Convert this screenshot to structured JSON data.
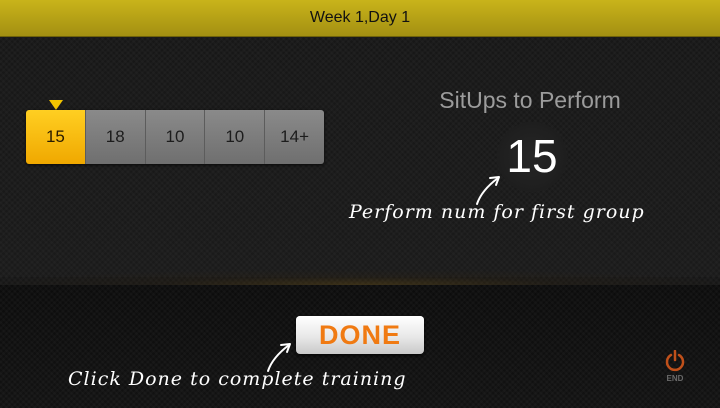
{
  "header": {
    "title": "Week 1,Day 1"
  },
  "sets": {
    "active_index": 0,
    "items": [
      "15",
      "18",
      "10",
      "10",
      "14+"
    ]
  },
  "exercise": {
    "heading": "SitUps to Perform",
    "current_count": "15"
  },
  "hints": {
    "first_group": "Perform num for first group",
    "done": "Click Done to complete training"
  },
  "actions": {
    "done_label": "DONE",
    "end_label": "END"
  },
  "colors": {
    "title_bar": "#b8a417",
    "active_set": "#f5b800",
    "done_text": "#f07a12",
    "end_icon": "#c0501a"
  },
  "icons": {
    "set_pointer": "triangle-down-icon",
    "hint_arrow": "arrow-icon",
    "end": "power-icon"
  }
}
